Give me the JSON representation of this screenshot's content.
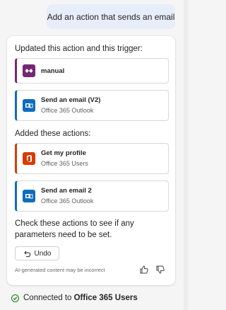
{
  "chat": {
    "user_message": "Add an action that sends an email"
  },
  "response": {
    "updated_heading": "Updated this action and this trigger:",
    "updated_items": [
      {
        "title": "manual",
        "subtitle": "",
        "color": "#742774",
        "icon": "flow-trigger-icon"
      },
      {
        "title": "Send an email (V2)",
        "subtitle": "Office 365 Outlook",
        "color": "#0f6cbd",
        "icon": "outlook-icon"
      }
    ],
    "added_heading": "Added these actions:",
    "added_items": [
      {
        "title": "Get my profile",
        "subtitle": "Office 365 Users",
        "color": "#d83b01",
        "icon": "office-icon"
      },
      {
        "title": "Send an email 2",
        "subtitle": "Office 365 Outlook",
        "color": "#0f6cbd",
        "icon": "outlook-icon"
      }
    ],
    "note": "Check these actions to see if any parameters need to be set.",
    "undo_label": "Undo",
    "disclaimer": "AI-generated content may be incorrect"
  },
  "status": {
    "prefix": "Connected to ",
    "service": "Office 365 Users"
  }
}
